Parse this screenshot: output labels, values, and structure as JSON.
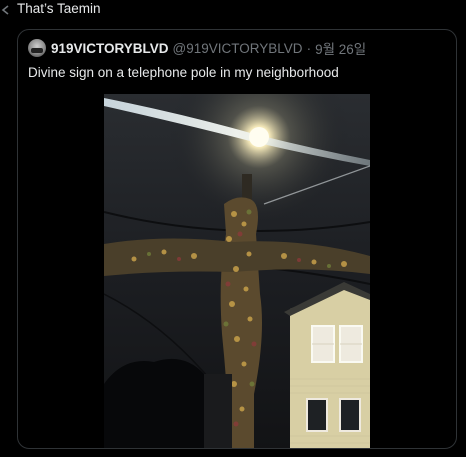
{
  "reply": {
    "text": "That’s Taemin",
    "icon": "reply-arrow-icon"
  },
  "quoted_tweet": {
    "display_name": "919VICTORYBLVD",
    "handle": "@919VICTORYBLVD",
    "separator": "·",
    "date": "9월 26일",
    "text": "Divine sign on a telephone pole in my neighborhood",
    "avatar": "avatar-image",
    "media": "photo-vine-covered-telephone-pole-cross"
  },
  "colors": {
    "background": "#000000",
    "primary_text": "#e7e9ea",
    "secondary_text": "#71767b",
    "border": "#2f3336"
  }
}
